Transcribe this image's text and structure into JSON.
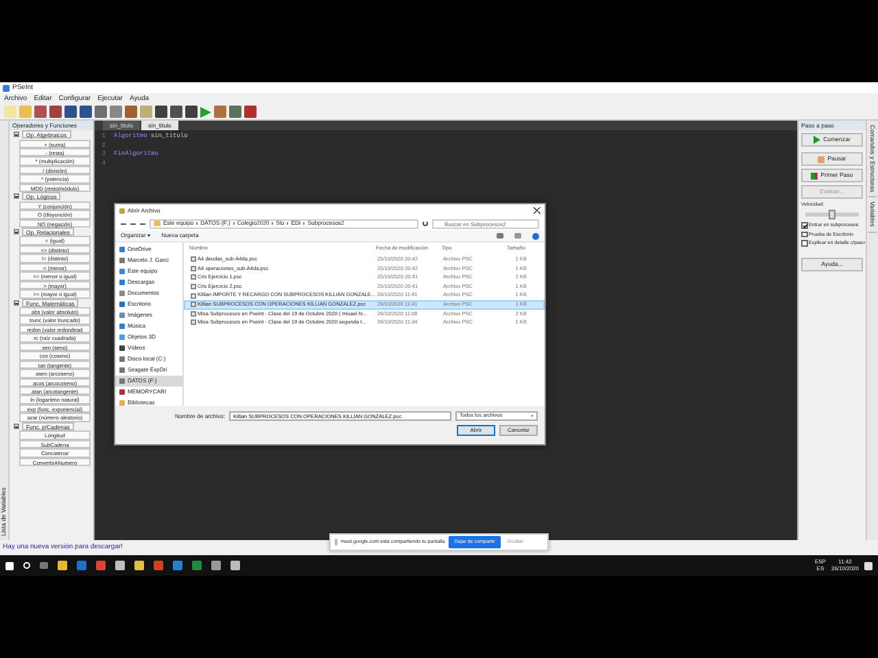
{
  "window": {
    "title": "PSeInt"
  },
  "menu": [
    "Archivo",
    "Editar",
    "Configurar",
    "Ejecutar",
    "Ayuda"
  ],
  "side_tab": "Lista de Variables",
  "operators": {
    "title": "Operadores y Funciones",
    "groups": [
      {
        "label": "Op. Algebraicos",
        "expanded": true,
        "items": [
          "+ (suma)",
          "- (resta)",
          "* (multiplicación)",
          "/ (división)",
          "^ (potencia)",
          "MOD (resto/módulo)"
        ]
      },
      {
        "label": "Op. Lógicos",
        "expanded": true,
        "items": [
          "Y (conjunción)",
          "O (disyunción)",
          "NO (negación)"
        ]
      },
      {
        "label": "Op. Relacionales",
        "expanded": true,
        "items": [
          "= (igual)",
          "<> (distinto)",
          "!= (distinto)",
          "< (menor)",
          "<= (menor o igual)",
          "> (mayor)",
          ">= (mayor o igual)"
        ]
      },
      {
        "label": "Func. Matemáticas",
        "expanded": true,
        "items": [
          "abs (valor absoluto)",
          "trunc (valor truncado)",
          "redon (valor redondead",
          "rc (raíz cuadrada)",
          "sen (seno)",
          "cos (coseno)",
          "tan (tangente)",
          "asen (arcoseno)",
          "acos (arcocoseno)",
          "atan (arcotangente)",
          "ln (logaritmo natural)",
          "exp (func. exponencial)",
          "azar (número aleatorio)"
        ]
      },
      {
        "label": "Func. p/Cadenas",
        "expanded": true,
        "items": [
          "Longitud",
          "SubCadena",
          "Concatenar",
          "ConvertirANumero"
        ]
      }
    ]
  },
  "editor": {
    "tabs": [
      {
        "label": "sin_titulo",
        "selected": false
      },
      {
        "label": "sin_titulo",
        "selected": true
      }
    ],
    "lines": [
      {
        "number": "1",
        "tokens": [
          {
            "text": "Algoritmo",
            "kind": "keyword"
          },
          {
            "text": "sin_titulo",
            "kind": "name"
          }
        ]
      },
      {
        "number": "2"
      },
      {
        "number": "3",
        "tokens": [
          {
            "text": "FinAlgoritmo",
            "kind": "keyword"
          }
        ]
      },
      {
        "number": "4"
      }
    ]
  },
  "step_panel": {
    "title": "Paso a paso",
    "buttons": [
      {
        "label": "Comenzar",
        "kind": "play",
        "disabled": false
      },
      {
        "label": "Pausar",
        "kind": "pause",
        "disabled": false
      },
      {
        "label": "Primer Paso",
        "kind": "step",
        "disabled": false
      },
      {
        "label": "Evaluar...",
        "kind": "plain",
        "disabled": true
      }
    ],
    "speed_label": "Velocidad:",
    "speed": {
      "level": 0.5
    },
    "options": [
      {
        "label": "Entrar en subprocesos",
        "checked": true
      },
      {
        "label": "Prueba de Escritorio",
        "checked": false
      },
      {
        "label": "Explicar en detalle c/paso",
        "checked": false
      }
    ],
    "help_button": "Ayuda..."
  },
  "right_tabs": [
    "Comandos y Estructuras",
    "Variables"
  ],
  "dialog": {
    "title": "Abrir Archivo",
    "path": [
      "Este equipo",
      "DATOS (F:)",
      "Colegio2020",
      "5to",
      "EDI",
      "Subprocesos2"
    ],
    "search": {
      "placeholder": "Buscar en Subprocesos2"
    },
    "organize": "Organizar ▾",
    "new_folder": "Nueva carpeta",
    "nav": [
      {
        "label": "OneDrive",
        "kind": "cloud",
        "selected": false
      },
      {
        "label": "Marcelo J. Garcí",
        "kind": "user",
        "selected": false
      },
      {
        "label": "Este equipo",
        "kind": "computer",
        "selected": false
      },
      {
        "label": "Descargas",
        "kind": "download",
        "selected": false
      },
      {
        "label": "Documentos",
        "kind": "document",
        "selected": false
      },
      {
        "label": "Escritorio",
        "kind": "desktop",
        "selected": false
      },
      {
        "label": "Imágenes",
        "kind": "image",
        "selected": false
      },
      {
        "label": "Música",
        "kind": "music",
        "selected": false
      },
      {
        "label": "Objetos 3D",
        "kind": "cube",
        "selected": false
      },
      {
        "label": "Vídeos",
        "kind": "video",
        "selected": false
      },
      {
        "label": "Disco local (C:)",
        "kind": "drive",
        "selected": false
      },
      {
        "label": "Seagate ExpDri",
        "kind": "drive",
        "selected": false
      },
      {
        "label": "DATOS (F:)",
        "kind": "drive",
        "selected": true
      },
      {
        "label": "MEMORYCARI",
        "kind": "card",
        "selected": false
      },
      {
        "label": "Bibliotecas",
        "kind": "folder",
        "selected": false
      }
    ],
    "columns": [
      "Nombre",
      "Fecha de modificación",
      "Tipo",
      "Tamaño"
    ],
    "files": [
      {
        "name": "A4 deudas_sub-A4da.psc",
        "date": "25/10/2020 20:42",
        "type": "Archivo PSC",
        "size": "1 KB",
        "selected": false
      },
      {
        "name": "A4 operaciones_sub-A4da.psc",
        "date": "25/10/2020 20:42",
        "type": "Archivo PSC",
        "size": "1 KB",
        "selected": false
      },
      {
        "name": "Cris Ejercicio 1.psc",
        "date": "25/10/2020 20:41",
        "type": "Archivo PSC",
        "size": "2 KB",
        "selected": false
      },
      {
        "name": "Cris Ejercicio 2.psc",
        "date": "25/10/2020 20:41",
        "type": "Archivo PSC",
        "size": "1 KB",
        "selected": false
      },
      {
        "name": "Killian IMPORTE Y RECARGO CON SUBPROCESOS KILLIAN GONZALE...",
        "date": "26/10/2020 11:41",
        "type": "Archivo PSC",
        "size": "1 KB",
        "selected": false
      },
      {
        "name": "Killian SUBPROCESOS CON OPERACIONES KILLIAN GONZALEZ.psc",
        "date": "26/10/2020 11:41",
        "type": "Archivo PSC",
        "size": "1 KB",
        "selected": true
      },
      {
        "name": "Misa Subprocesos en Pseint - Clase del 19 de Octubre 2020 ( misael hi...",
        "date": "26/10/2020 11:08",
        "type": "Archivo PSC",
        "size": "2 KB",
        "selected": false
      },
      {
        "name": "Misa Subprocesos en Pseint - Clase del 19 de Octubre 2020 segunda t...",
        "date": "26/10/2020 11:34",
        "type": "Archivo PSC",
        "size": "1 KB",
        "selected": false
      }
    ],
    "filename_label": "Nombre de archivo:",
    "filename": "Killian SUBPROCESOS CON OPERACIONES KILLIAN GONZALEZ.psc",
    "filter": "Todos los archivos",
    "open": "Abrir",
    "cancel": "Cancelar"
  },
  "status": "Hay una nueva versión para descargar!",
  "share_bar": {
    "message": "meet.google.com está compartiendo tu pantalla",
    "stop": "Dejar de compartir",
    "hide": "Ocultar"
  },
  "taskbar": {
    "language": "ESP",
    "layout": "ES",
    "time": "11:42",
    "date": "26/10/2020"
  }
}
